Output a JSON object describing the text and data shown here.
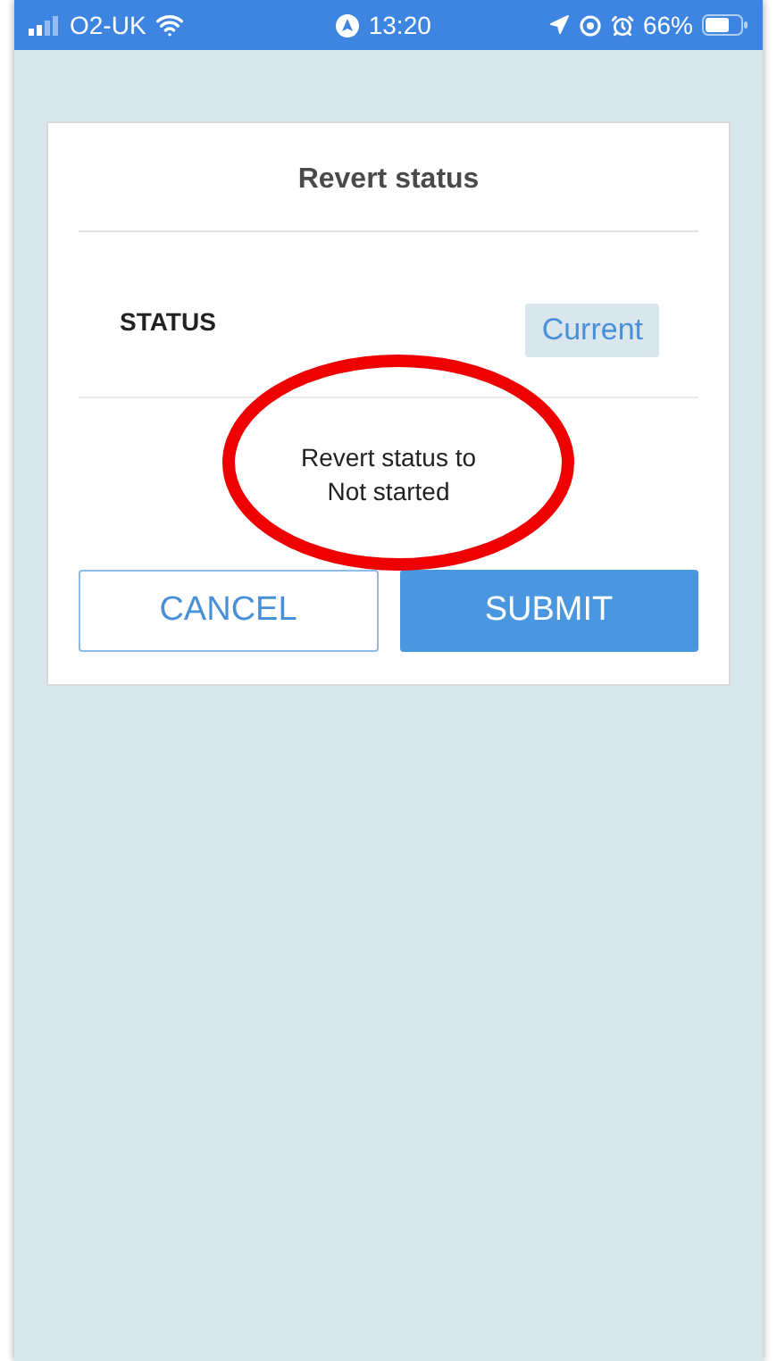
{
  "status_bar": {
    "carrier": "O2-UK",
    "time": "13:20",
    "battery": "66%"
  },
  "dialog": {
    "title": "Revert status",
    "field_label": "STATUS",
    "badge": "Current",
    "message_lines": [
      "Revert status to",
      "Not started"
    ],
    "buttons": [
      {
        "label": "CANCEL",
        "kind": "secondary"
      },
      {
        "label": "SUBMIT",
        "kind": "primary"
      }
    ]
  }
}
